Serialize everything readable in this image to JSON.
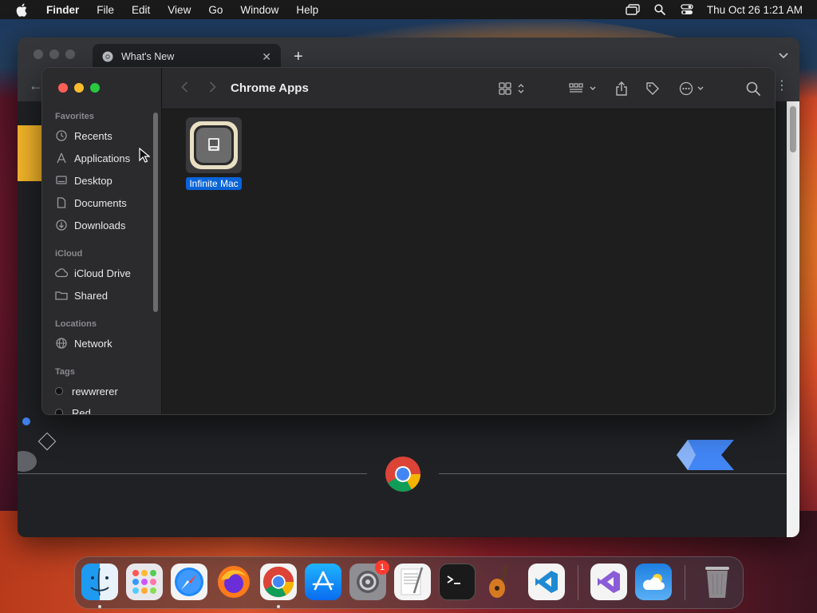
{
  "menubar": {
    "app_name": "Finder",
    "items": [
      "File",
      "Edit",
      "View",
      "Go",
      "Window",
      "Help"
    ],
    "clock": "Thu Oct 26  1:21 AM"
  },
  "chrome": {
    "tab_title": "What's New"
  },
  "finder": {
    "title": "Chrome Apps",
    "sidebar": {
      "favorites_heading": "Favorites",
      "favorites": [
        "Recents",
        "Applications",
        "Desktop",
        "Documents",
        "Downloads"
      ],
      "icloud_heading": "iCloud",
      "icloud": [
        "iCloud Drive",
        "Shared"
      ],
      "locations_heading": "Locations",
      "locations": [
        "Network"
      ],
      "tags_heading": "Tags",
      "tags": [
        "rewwrerer",
        "Red"
      ]
    },
    "files": [
      {
        "name": "Infinite Mac",
        "selected": true
      }
    ]
  },
  "dock": {
    "apps": [
      "Finder",
      "Launchpad",
      "Safari",
      "Firefox",
      "Google Chrome",
      "App Store",
      "System Settings",
      "TextEdit",
      "Terminal",
      "GarageBand",
      "Visual Studio Code",
      "Visual Studio",
      "Weather",
      "Trash"
    ],
    "system_settings_badge": "1"
  },
  "colors": {
    "selection": "#0a64d8",
    "close": "#ff5f57",
    "minimize": "#febc2e",
    "zoom": "#28c840"
  }
}
